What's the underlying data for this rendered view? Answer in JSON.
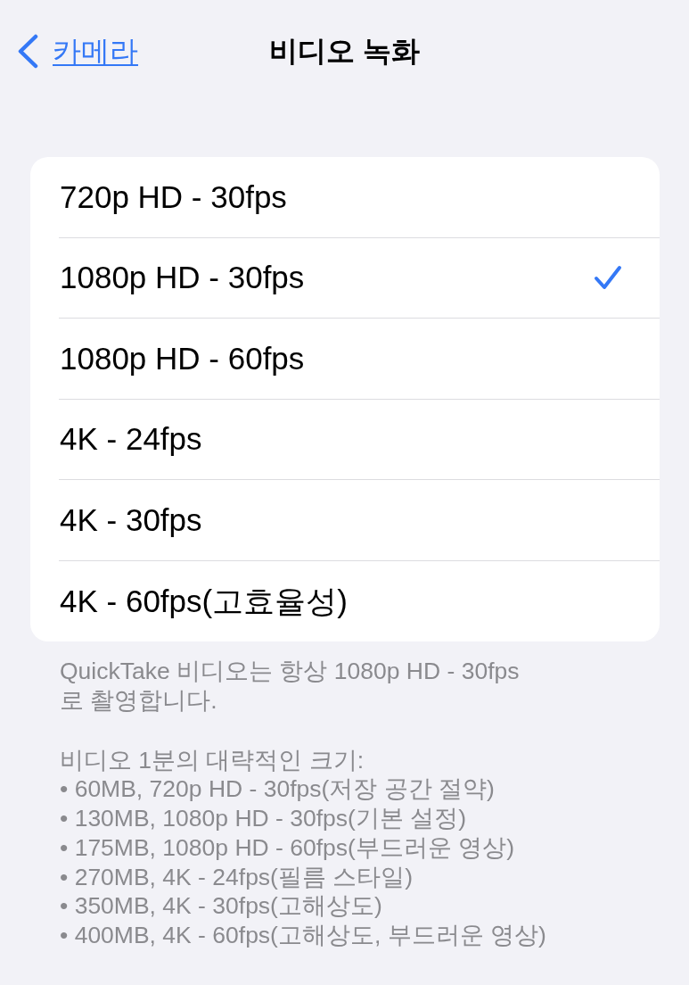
{
  "nav": {
    "back_label": "카메라",
    "title": "비디오 녹화"
  },
  "options": [
    {
      "label": "720p HD - 30fps",
      "selected": false
    },
    {
      "label": "1080p HD - 30fps",
      "selected": true
    },
    {
      "label": "1080p HD - 60fps",
      "selected": false
    },
    {
      "label": "4K - 24fps",
      "selected": false
    },
    {
      "label": "4K - 30fps",
      "selected": false
    },
    {
      "label": "4K - 60fps(고효율성)",
      "selected": false
    }
  ],
  "footer": {
    "note": "QuickTake 비디오는 항상 1080p HD - 30fps로 촬영합니다.",
    "sizes_heading": "비디오 1분의 대략적인 크기:",
    "sizes": [
      "• 60MB, 720p HD - 30fps(저장 공간 절약)",
      "• 130MB, 1080p HD - 30fps(기본 설정)",
      "• 175MB, 1080p HD - 60fps(부드러운 영상)",
      "• 270MB, 4K - 24fps(필름 스타일)",
      "• 350MB, 4K - 30fps(고해상도)",
      "• 400MB, 4K - 60fps(고해상도, 부드러운 영상)"
    ]
  }
}
